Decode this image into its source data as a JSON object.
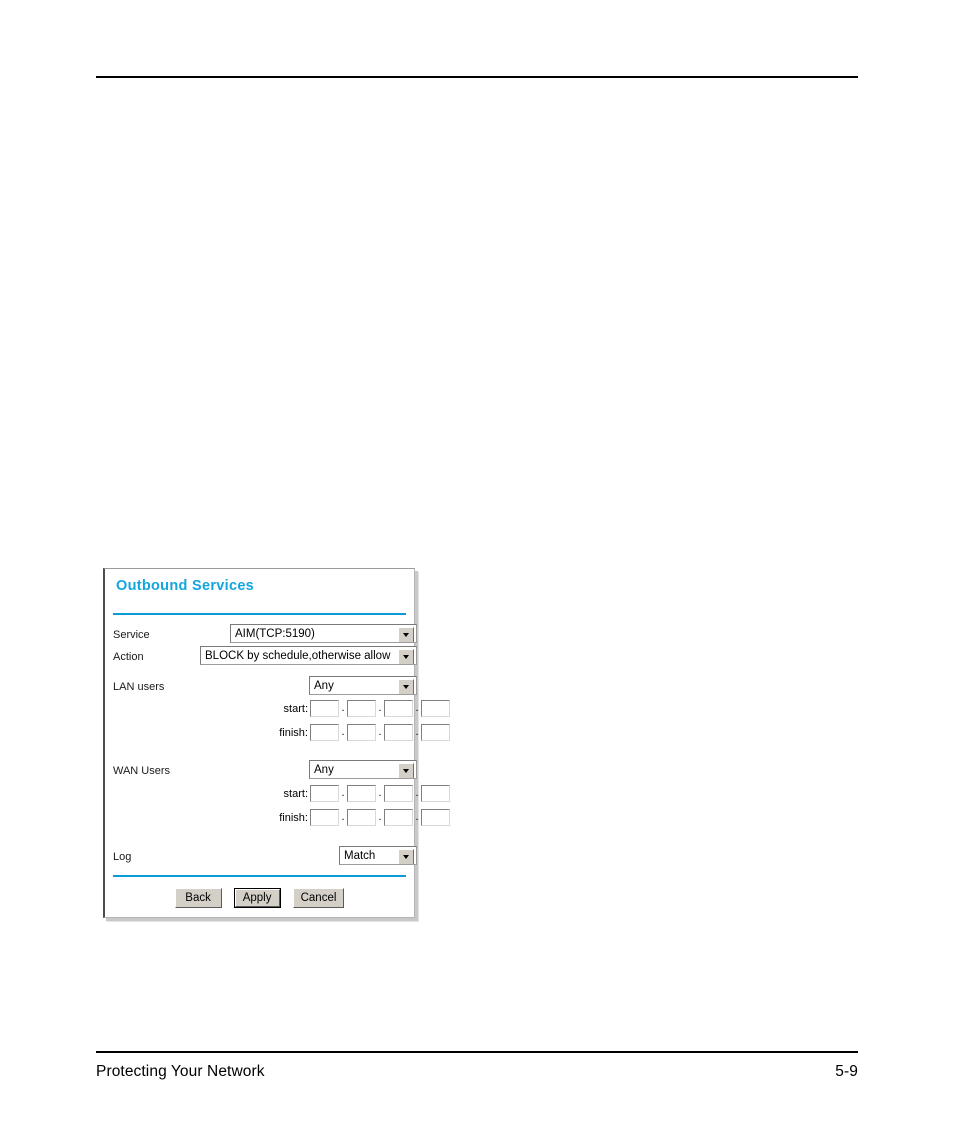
{
  "page": {
    "footer_left": "Protecting Your Network",
    "footer_right": "5-9"
  },
  "panel": {
    "title": "Outbound Services",
    "accent_color": "#0a9ad8",
    "fields": {
      "service": {
        "label": "Service",
        "value": "AIM(TCP:5190)"
      },
      "action": {
        "label": "Action",
        "value": "BLOCK by schedule,otherwise allow"
      },
      "lan_users": {
        "label": "LAN users",
        "value": "Any",
        "start_label": "start:",
        "finish_label": "finish:",
        "start_octets": [
          "",
          "",
          "",
          ""
        ],
        "finish_octets": [
          "",
          "",
          "",
          ""
        ]
      },
      "wan_users": {
        "label": "WAN Users",
        "value": "Any",
        "start_label": "start:",
        "finish_label": "finish:",
        "start_octets": [
          "",
          "",
          "",
          ""
        ],
        "finish_octets": [
          "",
          "",
          "",
          ""
        ]
      },
      "log": {
        "label": "Log",
        "value": "Match"
      }
    },
    "buttons": {
      "back": "Back",
      "apply": "Apply",
      "cancel": "Cancel"
    }
  }
}
